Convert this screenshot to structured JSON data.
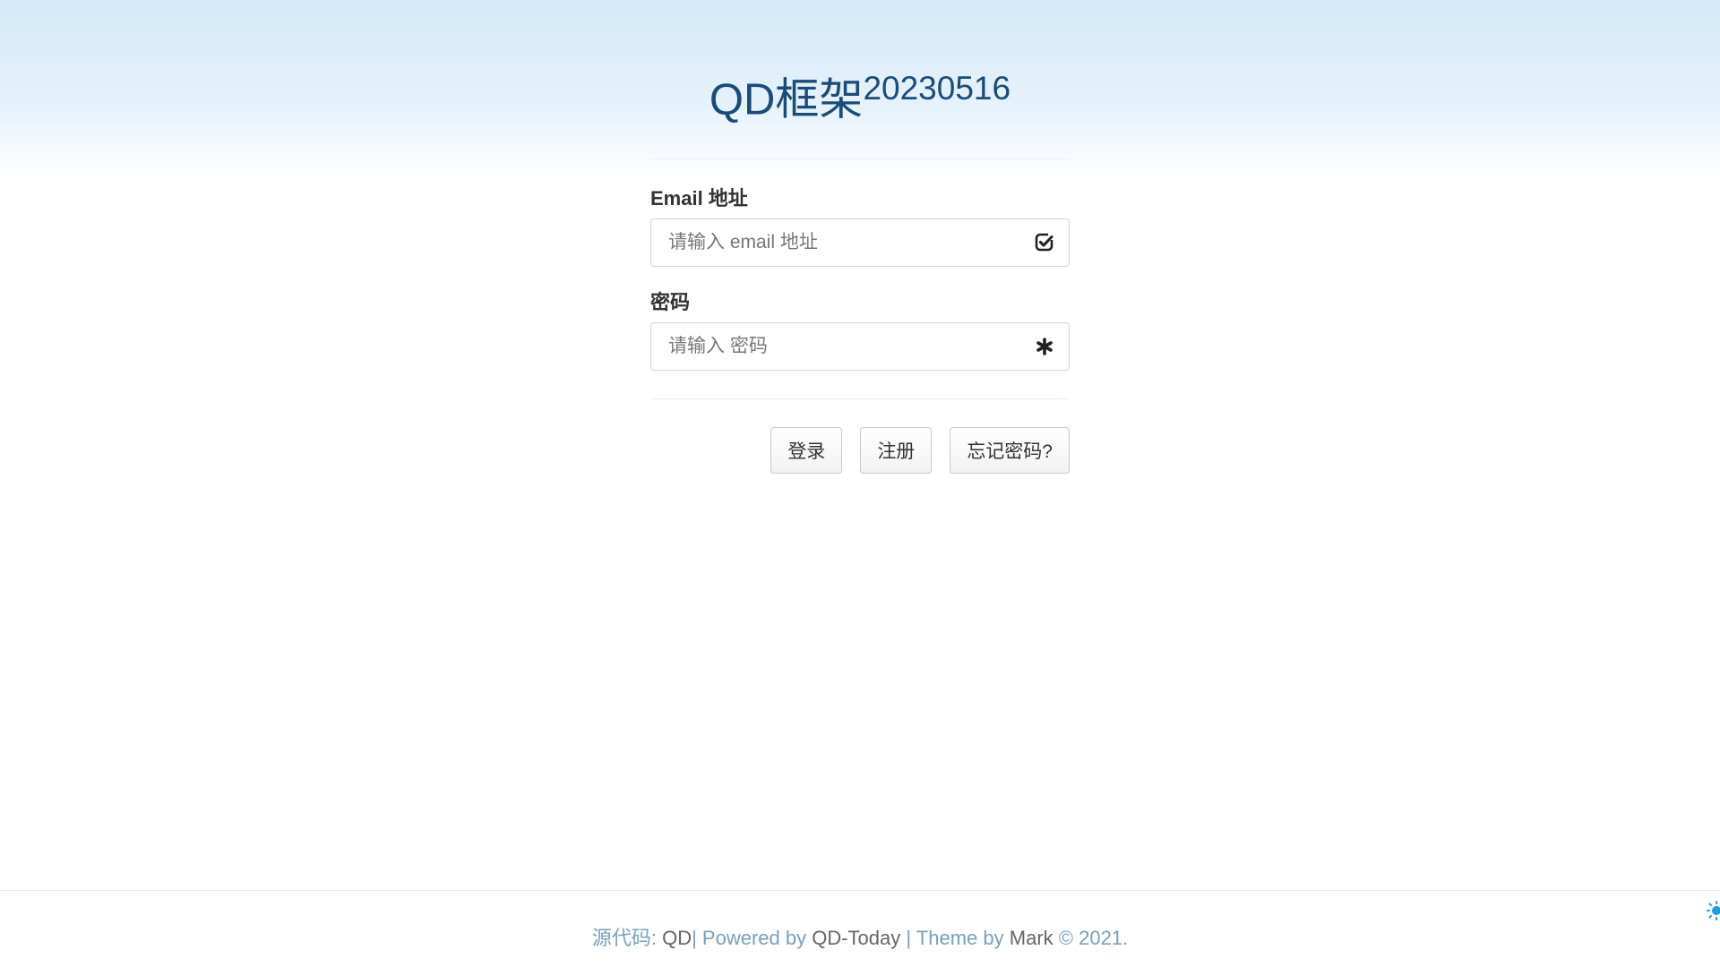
{
  "header": {
    "title": "QD框架",
    "version": "20230516"
  },
  "form": {
    "email_label": "Email 地址",
    "email_placeholder": "请输入 email 地址",
    "email_icon": "check-square-icon",
    "password_label": "密码",
    "password_placeholder": "请输入 密码",
    "password_icon": "asterisk-icon"
  },
  "buttons": {
    "login": "登录",
    "register": "注册",
    "forgot": "忘记密码?"
  },
  "footer": {
    "source_label": "源代码:",
    "source_link": "QD",
    "powered_label": "| Powered by",
    "powered_link": "QD-Today",
    "theme_label": "| Theme by",
    "theme_link": "Mark",
    "copyright": "© 2021."
  },
  "colors": {
    "title": "#1a4b7a",
    "footer_link": "#7a9fbf",
    "corner_icon": "#1e9be0"
  }
}
